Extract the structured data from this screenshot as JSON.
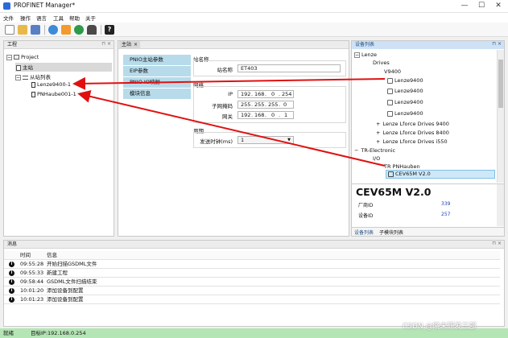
{
  "window": {
    "title": "PROFINET Manager*",
    "minimize": "—",
    "maximize": "☐",
    "close": "✕"
  },
  "menu": [
    "文件",
    "操作",
    "语言",
    "工具",
    "帮助",
    "关于"
  ],
  "project_panel": {
    "title": "工程",
    "root": "Project",
    "master": "主站",
    "slave_list": "从站列表",
    "slaves": [
      "Lenze9400-1",
      "PNHaube001-1"
    ]
  },
  "editor": {
    "tab": "主站",
    "nav": [
      "PNIO主站参数",
      "EIP参数",
      "PNIO IO映射",
      "模块信息"
    ],
    "station_group": "站名称",
    "station_label": "站名称",
    "station_value": "ET403",
    "network_group": "网络",
    "ip_label": "IP",
    "ip": [
      "192",
      "168",
      "0",
      "254"
    ],
    "mask_label": "子网掩码",
    "mask": [
      "255",
      "255",
      "255",
      "0"
    ],
    "gateway_label": "网关",
    "gateway": [
      "192",
      "168",
      "0",
      "1"
    ],
    "cycle_group": "周期",
    "send_clock_label": "发送时钟(ms)",
    "send_clock_value": "1"
  },
  "device_catalog": {
    "title": "设备列表",
    "vendor_lenze": "Lenze",
    "drives": "Drives",
    "v9400": "V9400",
    "v9400_items": [
      "Lenze9400",
      "Lenze9400",
      "Lenze9400",
      "Lenze9400"
    ],
    "lforce": [
      "Lenze Lforce Drives 9400",
      "Lenze Lforce Drives 8400",
      "Lenze Lforce Drives i550"
    ],
    "vendor_tr": "TR-Electronic",
    "io": "I/O",
    "tr_pnhauben": "TR PNHauben",
    "selected_device": "CEV65M V2.0",
    "detail_title": "CEV65M V2.0",
    "vendor_id_label": "厂商ID",
    "vendor_id_value": "339",
    "device_id_label": "设备ID",
    "device_id_value": "257",
    "tabs": [
      "设备列表",
      "子模块列表"
    ]
  },
  "log": {
    "title": "消息",
    "col_time": "时间",
    "col_info": "信息",
    "rows": [
      {
        "time": "09:55:28",
        "info": "开始扫描GSDML文件"
      },
      {
        "time": "09:55:33",
        "info": "新建工程"
      },
      {
        "time": "09:58:44",
        "info": "GSDML文件扫描结束"
      },
      {
        "time": "10:01:20",
        "info": "添加设备到配置"
      },
      {
        "time": "10:01:23",
        "info": "添加设备到配置"
      }
    ]
  },
  "status": {
    "state": "就绪",
    "target_ip": "目标IP:192.168.0.254"
  },
  "watermark": "CSDN @晓未研发三部",
  "colors": {
    "accent": "#cfe1f5",
    "nav_button": "#b7dbea",
    "status_bar": "#b4e5b4",
    "arrow": "#e01010",
    "value_link": "#1b3fb5"
  }
}
